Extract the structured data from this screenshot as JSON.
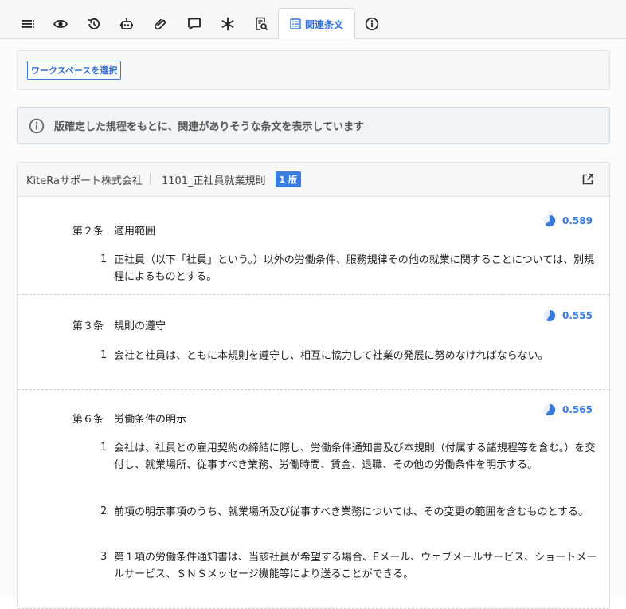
{
  "tabs": {
    "active_label": "関連条文",
    "icons": [
      "list-icon",
      "eye-icon",
      "history-icon",
      "robot-icon",
      "paperclip-icon",
      "comment-icon",
      "asterisk-icon",
      "search-doc-icon",
      "related-articles-icon",
      "info-icon"
    ]
  },
  "workspace": {
    "select_label": "ワークスペースを選択"
  },
  "info": {
    "text": "版確定した規程をもとに、関連がありそうな条文を表示しています"
  },
  "document": {
    "company": "KiteRaサポート株式会社",
    "name": "1101_正社員就業規則",
    "version_badge": "1 版"
  },
  "articles": [
    {
      "number": "第２条",
      "title": "適用範囲",
      "score": "0.589",
      "paragraphs": [
        {
          "num": "1",
          "text": "正社員（以下「社員」という。）以外の労働条件、服務規律その他の就業に関することについては、別規程によるものとする。"
        }
      ]
    },
    {
      "number": "第３条",
      "title": "規則の遵守",
      "score": "0.555",
      "paragraphs": [
        {
          "num": "1",
          "text": "会社と社員は、ともに本規則を遵守し、相互に協力して社業の発展に努めなければならない。"
        }
      ]
    },
    {
      "number": "第６条",
      "title": "労働条件の明示",
      "score": "0.565",
      "paragraphs": [
        {
          "num": "1",
          "text": "会社は、社員との雇用契約の締結に際し、労働条件通知書及び本規則（付属する諸規程等を含む。）を交付し、就業場所、従事すべき業務、労働時間、賃金、退職、その他の労働条件を明示する。"
        },
        {
          "num": "2",
          "text": "前項の明示事項のうち、就業場所及び従事すべき業務については、その変更の範囲を含むものとする。"
        },
        {
          "num": "3",
          "text": "第１項の労働条件通知書は、当該社員が希望する場合、Eメール、ウェブメールサービス、ショートメールサービス、ＳＮＳメッセージ機能等により送ることができる。"
        }
      ]
    }
  ]
}
